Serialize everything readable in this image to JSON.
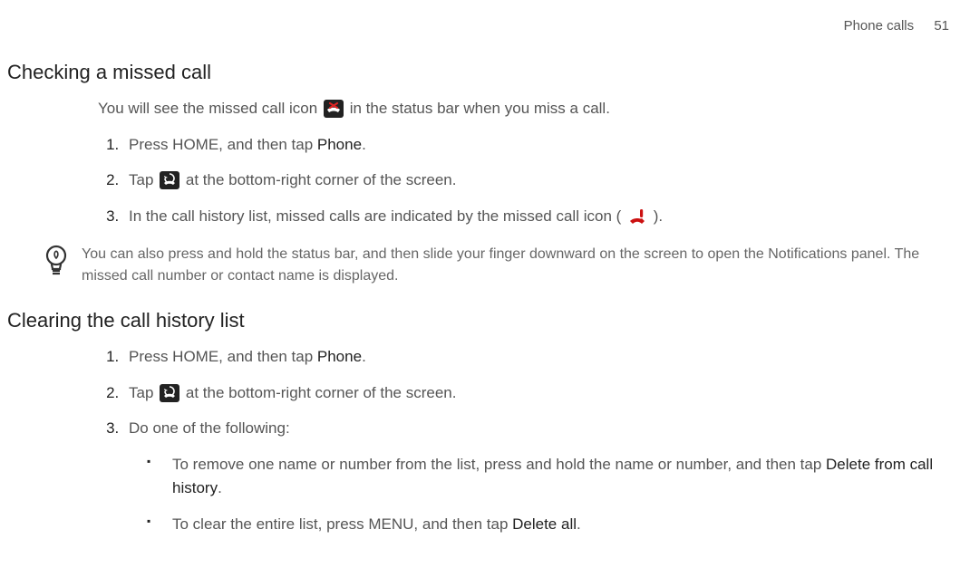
{
  "header": {
    "section_name": "Phone calls",
    "page_number": "51"
  },
  "section1": {
    "title": "Checking a missed call",
    "intro_a": "You will see the missed call icon ",
    "intro_b": " in the status bar when you miss a call.",
    "step1_a": "Press HOME, and then tap ",
    "step1_b": "Phone",
    "step1_c": ".",
    "step2_a": "Tap ",
    "step2_b": " at the bottom-right corner of the screen.",
    "step3_a": "In the call history list, missed calls are indicated by the missed call icon ( ",
    "step3_b": " ).",
    "tip": "You can also press and hold the status bar, and then slide your finger downward on the screen to open the Notifications panel. The missed call number or contact name is displayed."
  },
  "section2": {
    "title": "Clearing the call history list",
    "step1_a": "Press HOME, and then tap ",
    "step1_b": "Phone",
    "step1_c": ".",
    "step2_a": "Tap ",
    "step2_b": " at the bottom-right corner of the screen.",
    "step3": "Do one of the following:",
    "sub1_a": "To remove one name or number from the list, press and hold the name or number, and then tap ",
    "sub1_b": "Delete from call history",
    "sub1_c": ".",
    "sub2_a": "To clear the entire list, press MENU, and then tap ",
    "sub2_b": "Delete all",
    "sub2_c": "."
  }
}
